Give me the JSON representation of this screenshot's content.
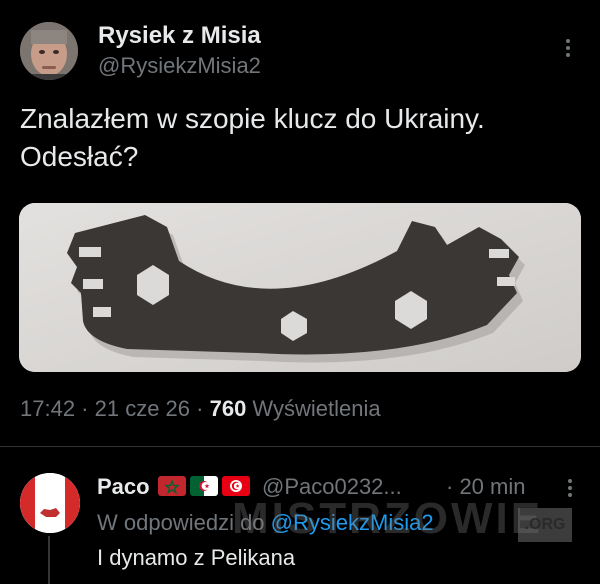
{
  "tweet": {
    "author_name": "Rysiek z Misia",
    "author_handle": "@RysiekzMisia2",
    "text_line1": "Znalazłem w szopie klucz do Ukrainy.",
    "text_line2": "Odesłać?",
    "time": "17:42",
    "sep1": " · ",
    "date": "21 cze 26",
    "sep2": " · ",
    "views_count": "760",
    "views_label": " Wyświetlenia",
    "more_icon": "more-vertical-icon"
  },
  "reply": {
    "author_name": "Paco",
    "flags": [
      "morocco-flag-icon",
      "algeria-flag-icon",
      "tunisia-flag-icon"
    ],
    "author_handle": "@Paco0232...",
    "time": "· 20 min",
    "context_prefix": "W odpowiedzi do ",
    "context_mention": "@RysiekzMisia2",
    "text": "I dynamo z Pelikana"
  },
  "watermark": {
    "text": "MISTRZOWIE",
    "suffix": ".ORG"
  },
  "colors": {
    "background": "#000000",
    "text_primary": "#e7e9ea",
    "text_secondary": "#71767b",
    "link": "#1d9bf0",
    "divider": "#2f3336"
  }
}
